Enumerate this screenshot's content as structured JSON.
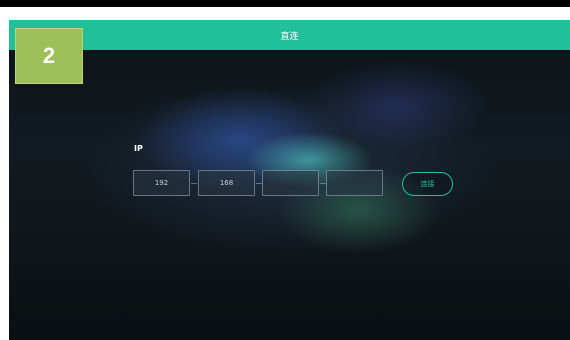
{
  "step_number": "2",
  "header": {
    "title": "直连"
  },
  "form": {
    "ip_label": "IP",
    "ip_fields": [
      "192",
      "168",
      "",
      ""
    ],
    "connect_label": "连接"
  },
  "colors": {
    "accent": "#21c09a",
    "badge": "#9dc05a",
    "background": "#10161b"
  }
}
